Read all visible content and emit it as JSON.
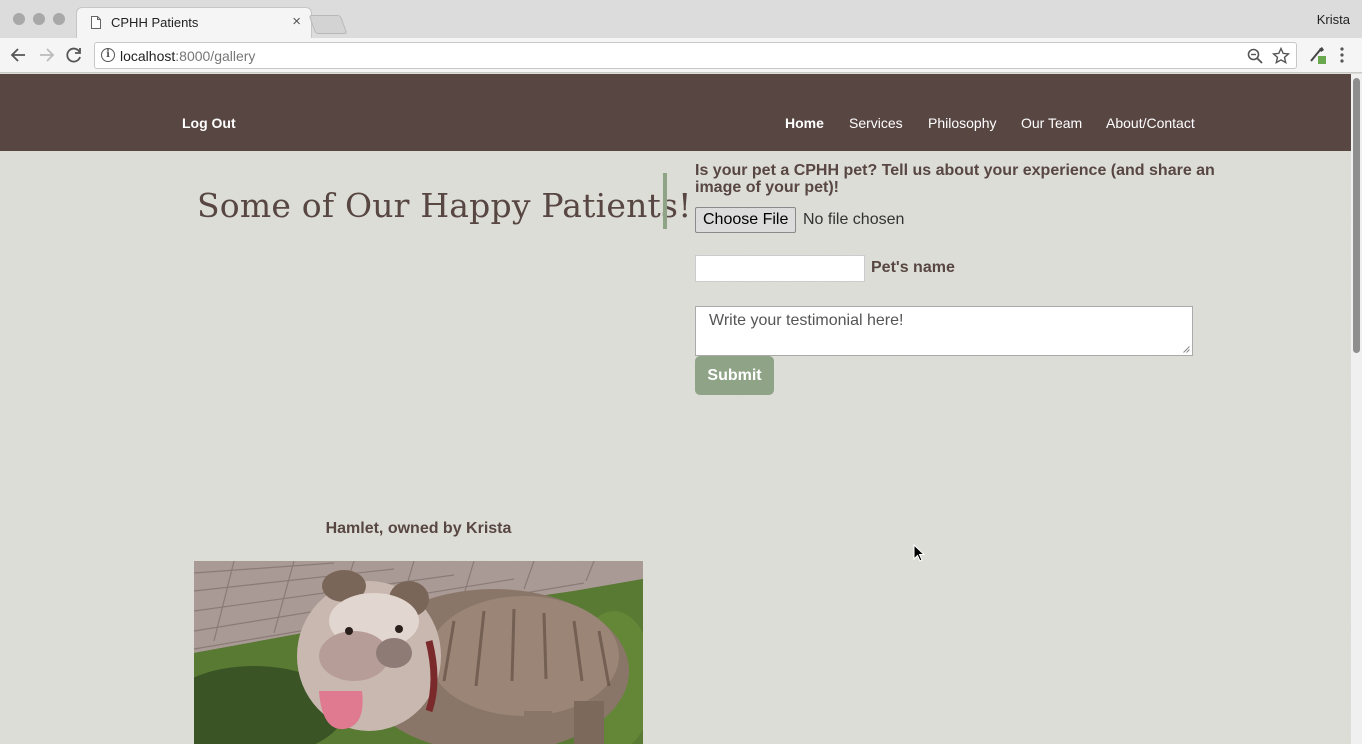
{
  "browser": {
    "tab_title": "CPHH Patients",
    "tab_close": "×",
    "profile_name": "Krista",
    "url_host": "localhost",
    "url_path": ":8000/gallery"
  },
  "site": {
    "logout": "Log Out",
    "nav": [
      "Home",
      "Services",
      "Philosophy",
      "Our Team",
      "About/Contact"
    ],
    "active_nav": "Home",
    "colors": {
      "header": "#584643",
      "accent": "#8fa386"
    }
  },
  "gallery": {
    "title": "Some of Our Happy Patients!",
    "caption": "Hamlet, owned by Krista"
  },
  "form": {
    "prompt": "Is your pet a CPHH pet? Tell us about your experience (and share an image of your pet)!",
    "file_button": "Choose File",
    "file_status": "No file chosen",
    "pet_name_value": "",
    "pet_name_label": "Pet's name",
    "testimonial_placeholder": "Write your testimonial here!",
    "submit": "Submit"
  }
}
